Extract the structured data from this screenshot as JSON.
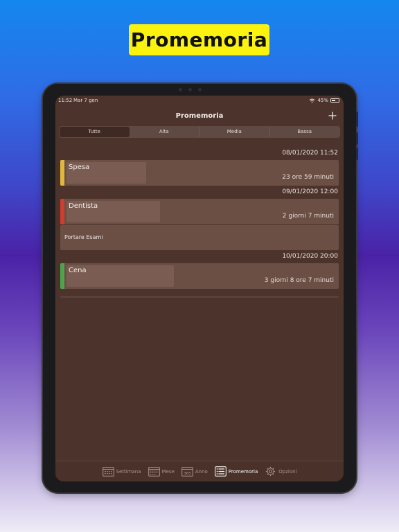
{
  "banner": {
    "title": "Promemoria"
  },
  "status_bar": {
    "time": "11:52",
    "date": "Mar 7 gen",
    "battery": "45%"
  },
  "nav": {
    "title": "Promemoria",
    "add_icon": "plus-icon"
  },
  "filter": {
    "options": [
      "Tutte",
      "Alta",
      "Media",
      "Bassa"
    ],
    "selected": "Tutte"
  },
  "reminders": [
    {
      "date": "08/01/2020 11:52",
      "title": "Spesa",
      "remaining": "23 ore 59 minuti",
      "priority_color": "#e2b83c",
      "note": ""
    },
    {
      "date": "09/01/2020 12:00",
      "title": "Dentista",
      "remaining": "2 giorni  7 minuti",
      "priority_color": "#cf3d2e",
      "note": "Portare Esami"
    },
    {
      "date": "10/01/2020 20:00",
      "title": "Cena",
      "remaining": "3 giorni 8 ore 7 minuti",
      "priority_color": "#4ca54c",
      "note": ""
    }
  ],
  "tabbar": {
    "items": [
      {
        "label": "Settimana",
        "icon": "calendar-week-icon",
        "active": false
      },
      {
        "label": "Mese",
        "icon": "calendar-month-icon",
        "active": false
      },
      {
        "label": "Anno",
        "icon": "calendar-365-icon",
        "icon_text": "365",
        "active": false
      },
      {
        "label": "Promemoria",
        "icon": "list-icon",
        "active": true
      },
      {
        "label": "Opzioni",
        "icon": "gear-icon",
        "active": false
      }
    ]
  }
}
